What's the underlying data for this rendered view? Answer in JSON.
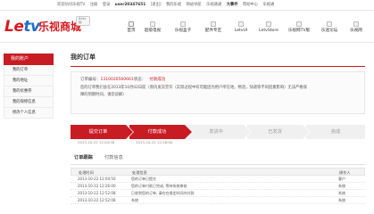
{
  "topbar": {
    "links": [
      "欢迎访问乐视TV",
      "注册",
      "登录",
      "user20347651",
      "[退出]",
      "我的乐视",
      "网站导航",
      "乐视通通",
      "大事件",
      "帮助中心",
      "乐视通"
    ],
    "user": "user20347651"
  },
  "logo": {
    "brand": "Letv",
    "brand_l": "Le",
    "brand_r": "tv",
    "name": "乐视商城",
    "beta": "Beta版"
  },
  "nav": [
    {
      "label": "首页",
      "icon": "home-icon"
    },
    {
      "label": "超级电视",
      "icon": "tv-icon"
    },
    {
      "label": "乐视盒子",
      "icon": "box-icon"
    },
    {
      "label": "配件专区",
      "icon": "accessory-icon"
    },
    {
      "label": "LetvUI",
      "icon": "ui-icon"
    },
    {
      "label": "LetvStore",
      "icon": "store-icon"
    },
    {
      "label": "乐视网TV版",
      "icon": "tv-site-icon"
    },
    {
      "label": "乐迷论坛",
      "icon": "forum-icon"
    },
    {
      "label": "乐视网",
      "icon": "site-icon"
    }
  ],
  "sidebar": {
    "title": "我的账户",
    "items": [
      "我的订单",
      "我的地址",
      "我的优惠券",
      "我的保修信息",
      "修改个人信息"
    ]
  },
  "main": {
    "title": "我的订单",
    "order_no_label": "订单编号：",
    "order_no": "1310020560661",
    "status_label": "状态：",
    "status": "付款成功",
    "line2": "您的订单我们会在2013年10月02日前（周内发货完毕（实际过程中有可能因为用户所在地，物流，快递等不同因素影响）无法严格保",
    "line3": "障的到期时间，请您谅解）"
  },
  "progress": {
    "steps": [
      {
        "label": "提交订单",
        "done": true,
        "time": "2013-10-22  12:04:56"
      },
      {
        "label": "付款成功",
        "done": true,
        "time": "2013-10-22  12:26:00"
      },
      {
        "label": "发货中",
        "done": false,
        "time": ""
      },
      {
        "label": "已发货",
        "done": false,
        "time": ""
      },
      {
        "label": "完成",
        "done": false,
        "time": ""
      }
    ]
  },
  "tabs": {
    "tab1": "订单跟踪",
    "tab2": "付款信息"
  },
  "table": {
    "headers": [
      "处理时间",
      "处理信息",
      "操作人"
    ],
    "rows": [
      [
        "2013-10-22  12:04:50",
        "您的订单已提交",
        "客户"
      ],
      [
        "2013-10-22  12:26:00",
        "您的订单付款已完成, 等待系统审核",
        "系统"
      ],
      [
        "2013-10-22  12:52:08",
        "已收到您的订单, 请在在限定时间内付款",
        "系统"
      ],
      [
        "2013-10-22  12:52:08",
        "系统",
        "系统"
      ]
    ]
  }
}
